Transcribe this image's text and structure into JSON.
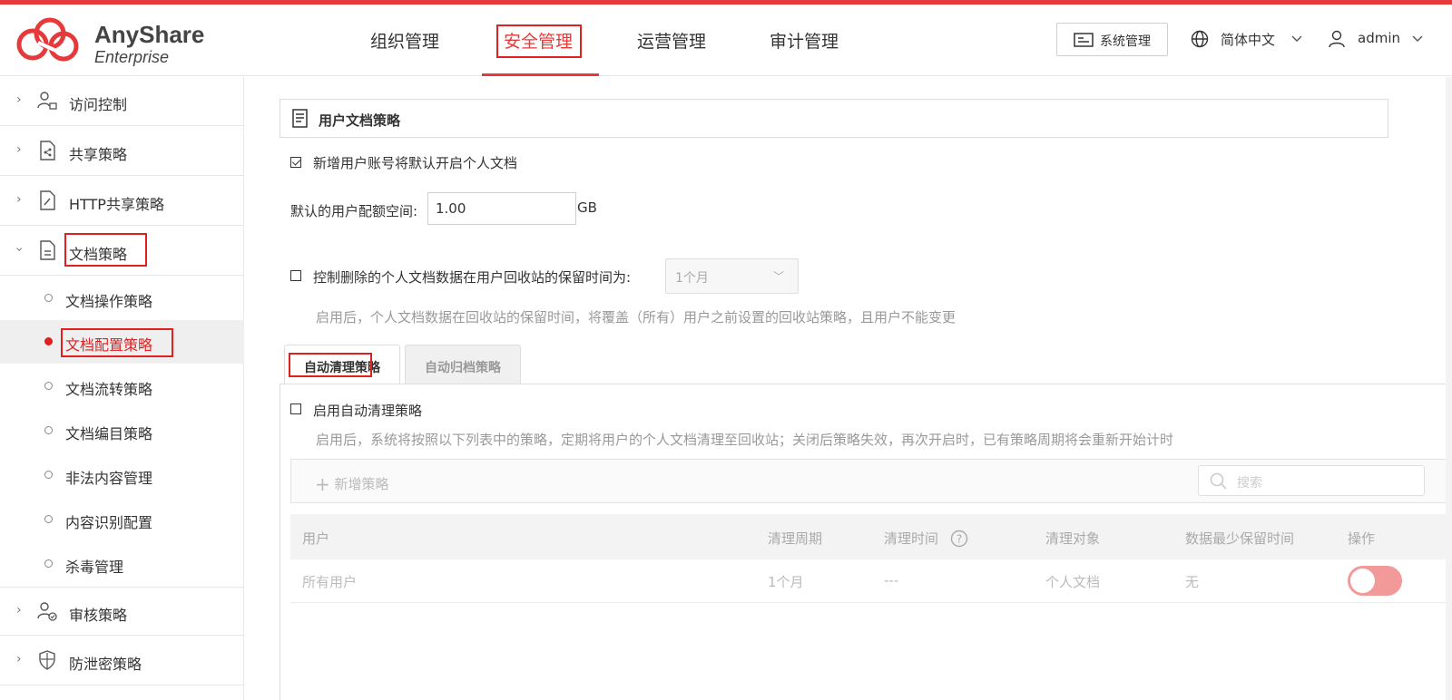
{
  "brand": {
    "title": "AnyShare",
    "subtitle": "Enterprise",
    "accent": "#e63a3a"
  },
  "nav": {
    "items": [
      "组织管理",
      "安全管理",
      "运营管理",
      "审计管理"
    ],
    "active_index": 1
  },
  "header_right": {
    "system_button": "系统管理",
    "language": "简体中文",
    "user": "admin",
    "icons": [
      "monitor-icon",
      "globe-icon",
      "user-icon"
    ]
  },
  "sidebar": {
    "groups_top": [
      {
        "label": "访问控制",
        "icon": "user-lock-icon"
      },
      {
        "label": "共享策略",
        "icon": "share-doc-icon"
      },
      {
        "label": "HTTP共享策略",
        "icon": "link-doc-icon"
      },
      {
        "label": "文档策略",
        "icon": "doc-icon",
        "expanded": true
      }
    ],
    "sub_items": [
      "文档操作策略",
      "文档配置策略",
      "文档流转策略",
      "文档编目策略",
      "非法内容管理",
      "内容识别配置",
      "杀毒管理"
    ],
    "active_sub_index": 1,
    "groups_bottom": [
      {
        "label": "审核策略",
        "icon": "user-check-icon"
      },
      {
        "label": "防泄密策略",
        "icon": "shield-icon"
      }
    ]
  },
  "main": {
    "section_title": "用户文档策略",
    "enable_personal_doc": {
      "label": "新增用户账号将默认开启个人文档",
      "checked": true
    },
    "quota": {
      "label": "默认的用户配额空间:",
      "value": "1.00",
      "unit": "GB"
    },
    "retention": {
      "label": "控制删除的个人文档数据在用户回收站的保留时间为:",
      "checked": false,
      "select_value": "1个月",
      "hint": "启用后，个人文档数据在回收站的保留时间，将覆盖（所有）用户之前设置的回收站策略，且用户不能变更"
    },
    "tabs": [
      "自动清理策略",
      "自动归档策略"
    ],
    "active_tab": 0,
    "auto_clean": {
      "label": "启用自动清理策略",
      "checked": false,
      "hint": "启用后，系统将按照以下列表中的策略，定期将用户的个人文档清理至回收站；关闭后策略失效，再次开启时，已有策略周期将会重新开始计时"
    },
    "toolbar": {
      "add_label": "新增策略",
      "search_placeholder": "搜索"
    },
    "table": {
      "columns": [
        "用户",
        "清理周期",
        "清理时间",
        "清理对象",
        "数据最少保留时间",
        "操作"
      ],
      "rows": [
        {
          "user": "所有用户",
          "cycle": "1个月",
          "time": "---",
          "target": "个人文档",
          "min_retention": "无",
          "enabled": true
        }
      ]
    }
  }
}
